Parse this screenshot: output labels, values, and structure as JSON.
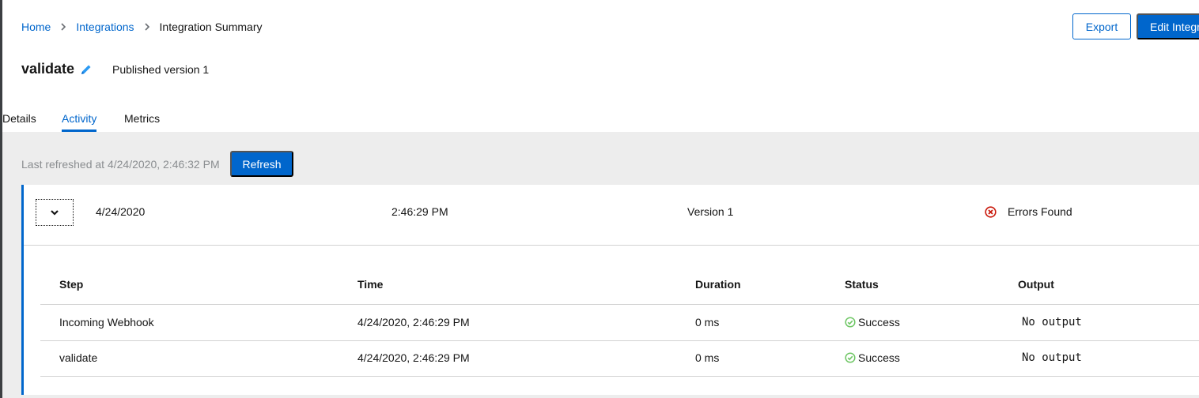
{
  "breadcrumb": {
    "home": "Home",
    "integrations": "Integrations",
    "current": "Integration Summary"
  },
  "header": {
    "export_label": "Export",
    "edit_label": "Edit Integration"
  },
  "integration": {
    "name": "validate",
    "published": "Published version 1"
  },
  "tabs": [
    {
      "label": "Details"
    },
    {
      "label": "Activity"
    },
    {
      "label": "Metrics"
    }
  ],
  "activity": {
    "last_refreshed": "Last refreshed at 4/24/2020, 2:46:32 PM",
    "refresh_label": "Refresh",
    "entry": {
      "date": "4/24/2020",
      "time": "2:46:29 PM",
      "version": "Version 1",
      "status": "Errors Found"
    },
    "steps_columns": [
      "Step",
      "Time",
      "Duration",
      "Status",
      "Output"
    ],
    "steps": [
      {
        "step": "Incoming Webhook",
        "time": "4/24/2020, 2:46:29 PM",
        "duration": "0 ms",
        "status": "Success",
        "output": "No output"
      },
      {
        "step": "validate",
        "time": "4/24/2020, 2:46:29 PM",
        "duration": "0 ms",
        "status": "Success",
        "output": "No output"
      }
    ]
  },
  "colors": {
    "accent": "#0066cc",
    "error": "#c9190b",
    "success": "#3e8635"
  }
}
